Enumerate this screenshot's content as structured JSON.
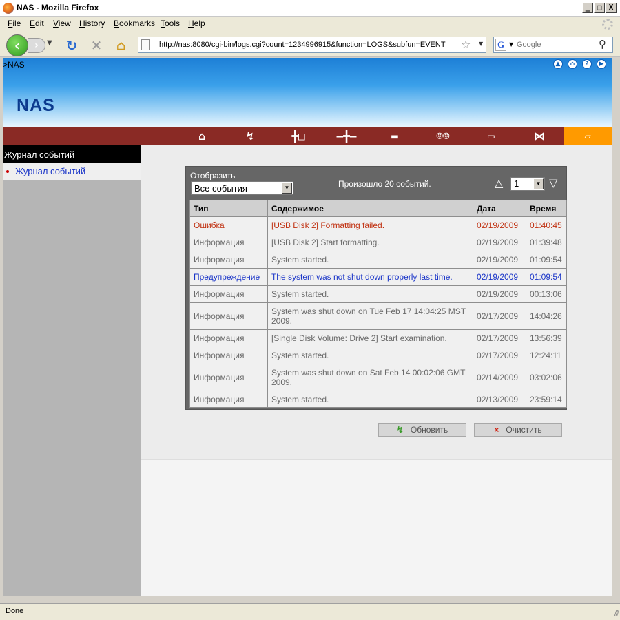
{
  "window": {
    "title": "NAS - Mozilla Firefox",
    "min_glyph": "_",
    "max_glyph": "□",
    "close_glyph": "X"
  },
  "menu": [
    "File",
    "Edit",
    "View",
    "History",
    "Bookmarks",
    "Tools",
    "Help"
  ],
  "toolbar": {
    "url": "http://nas:8080/cgi-bin/logs.cgi?count=1234996915&function=LOGS&subfun=EVENT",
    "search_placeholder": "Google"
  },
  "banner": {
    "breadcrumb": ">NAS",
    "brand": "NAS"
  },
  "nav_icons": [
    "home-icon",
    "lightning-icon",
    "plug-icon",
    "network-icon",
    "storage-icon",
    "users-icon",
    "folder-icon",
    "bowtie-icon",
    "note-icon"
  ],
  "sidebar": {
    "heading": "Журнал событий",
    "item": "Журнал событий"
  },
  "panel": {
    "filter_label": "Отобразить",
    "filter_value": "Все события",
    "count_text": "Произошло 20 событий.",
    "page_value": "1"
  },
  "table": {
    "headers": [
      "Тип",
      "Содержимое",
      "Дата",
      "Время"
    ],
    "rows": [
      {
        "type": "Ошибка",
        "content": "[USB Disk 2] Formatting failed.",
        "date": "02/19/2009",
        "time": "01:40:45",
        "level": "error"
      },
      {
        "type": "Информация",
        "content": "[USB Disk 2] Start formatting.",
        "date": "02/19/2009",
        "time": "01:39:48",
        "level": "info"
      },
      {
        "type": "Информация",
        "content": "System started.",
        "date": "02/19/2009",
        "time": "01:09:54",
        "level": "info"
      },
      {
        "type": "Предупреждение",
        "content": "The system was not shut down properly last time.",
        "date": "02/19/2009",
        "time": "01:09:54",
        "level": "warning"
      },
      {
        "type": "Информация",
        "content": "System started.",
        "date": "02/19/2009",
        "time": "00:13:06",
        "level": "info"
      },
      {
        "type": "Информация",
        "content": "System was shut down on Tue Feb 17 14:04:25 MST 2009.",
        "date": "02/17/2009",
        "time": "14:04:26",
        "level": "info"
      },
      {
        "type": "Информация",
        "content": "[Single Disk Volume: Drive 2] Start examination.",
        "date": "02/17/2009",
        "time": "13:56:39",
        "level": "info"
      },
      {
        "type": "Информация",
        "content": "System started.",
        "date": "02/17/2009",
        "time": "12:24:11",
        "level": "info"
      },
      {
        "type": "Информация",
        "content": "System was shut down on Sat Feb 14 00:02:06 GMT 2009.",
        "date": "02/14/2009",
        "time": "03:02:06",
        "level": "info"
      },
      {
        "type": "Информация",
        "content": "System started.",
        "date": "02/13/2009",
        "time": "23:59:14",
        "level": "info"
      }
    ]
  },
  "buttons": {
    "refresh": "Обновить",
    "clear": "Очистить"
  },
  "status": "Done",
  "colors": {
    "error": "#c03010",
    "warning": "#1a35c8",
    "info": "#6a6a6a",
    "nav_bar": "#8a2a25",
    "nav_active": "#ff9a00",
    "panel": "#666666"
  }
}
